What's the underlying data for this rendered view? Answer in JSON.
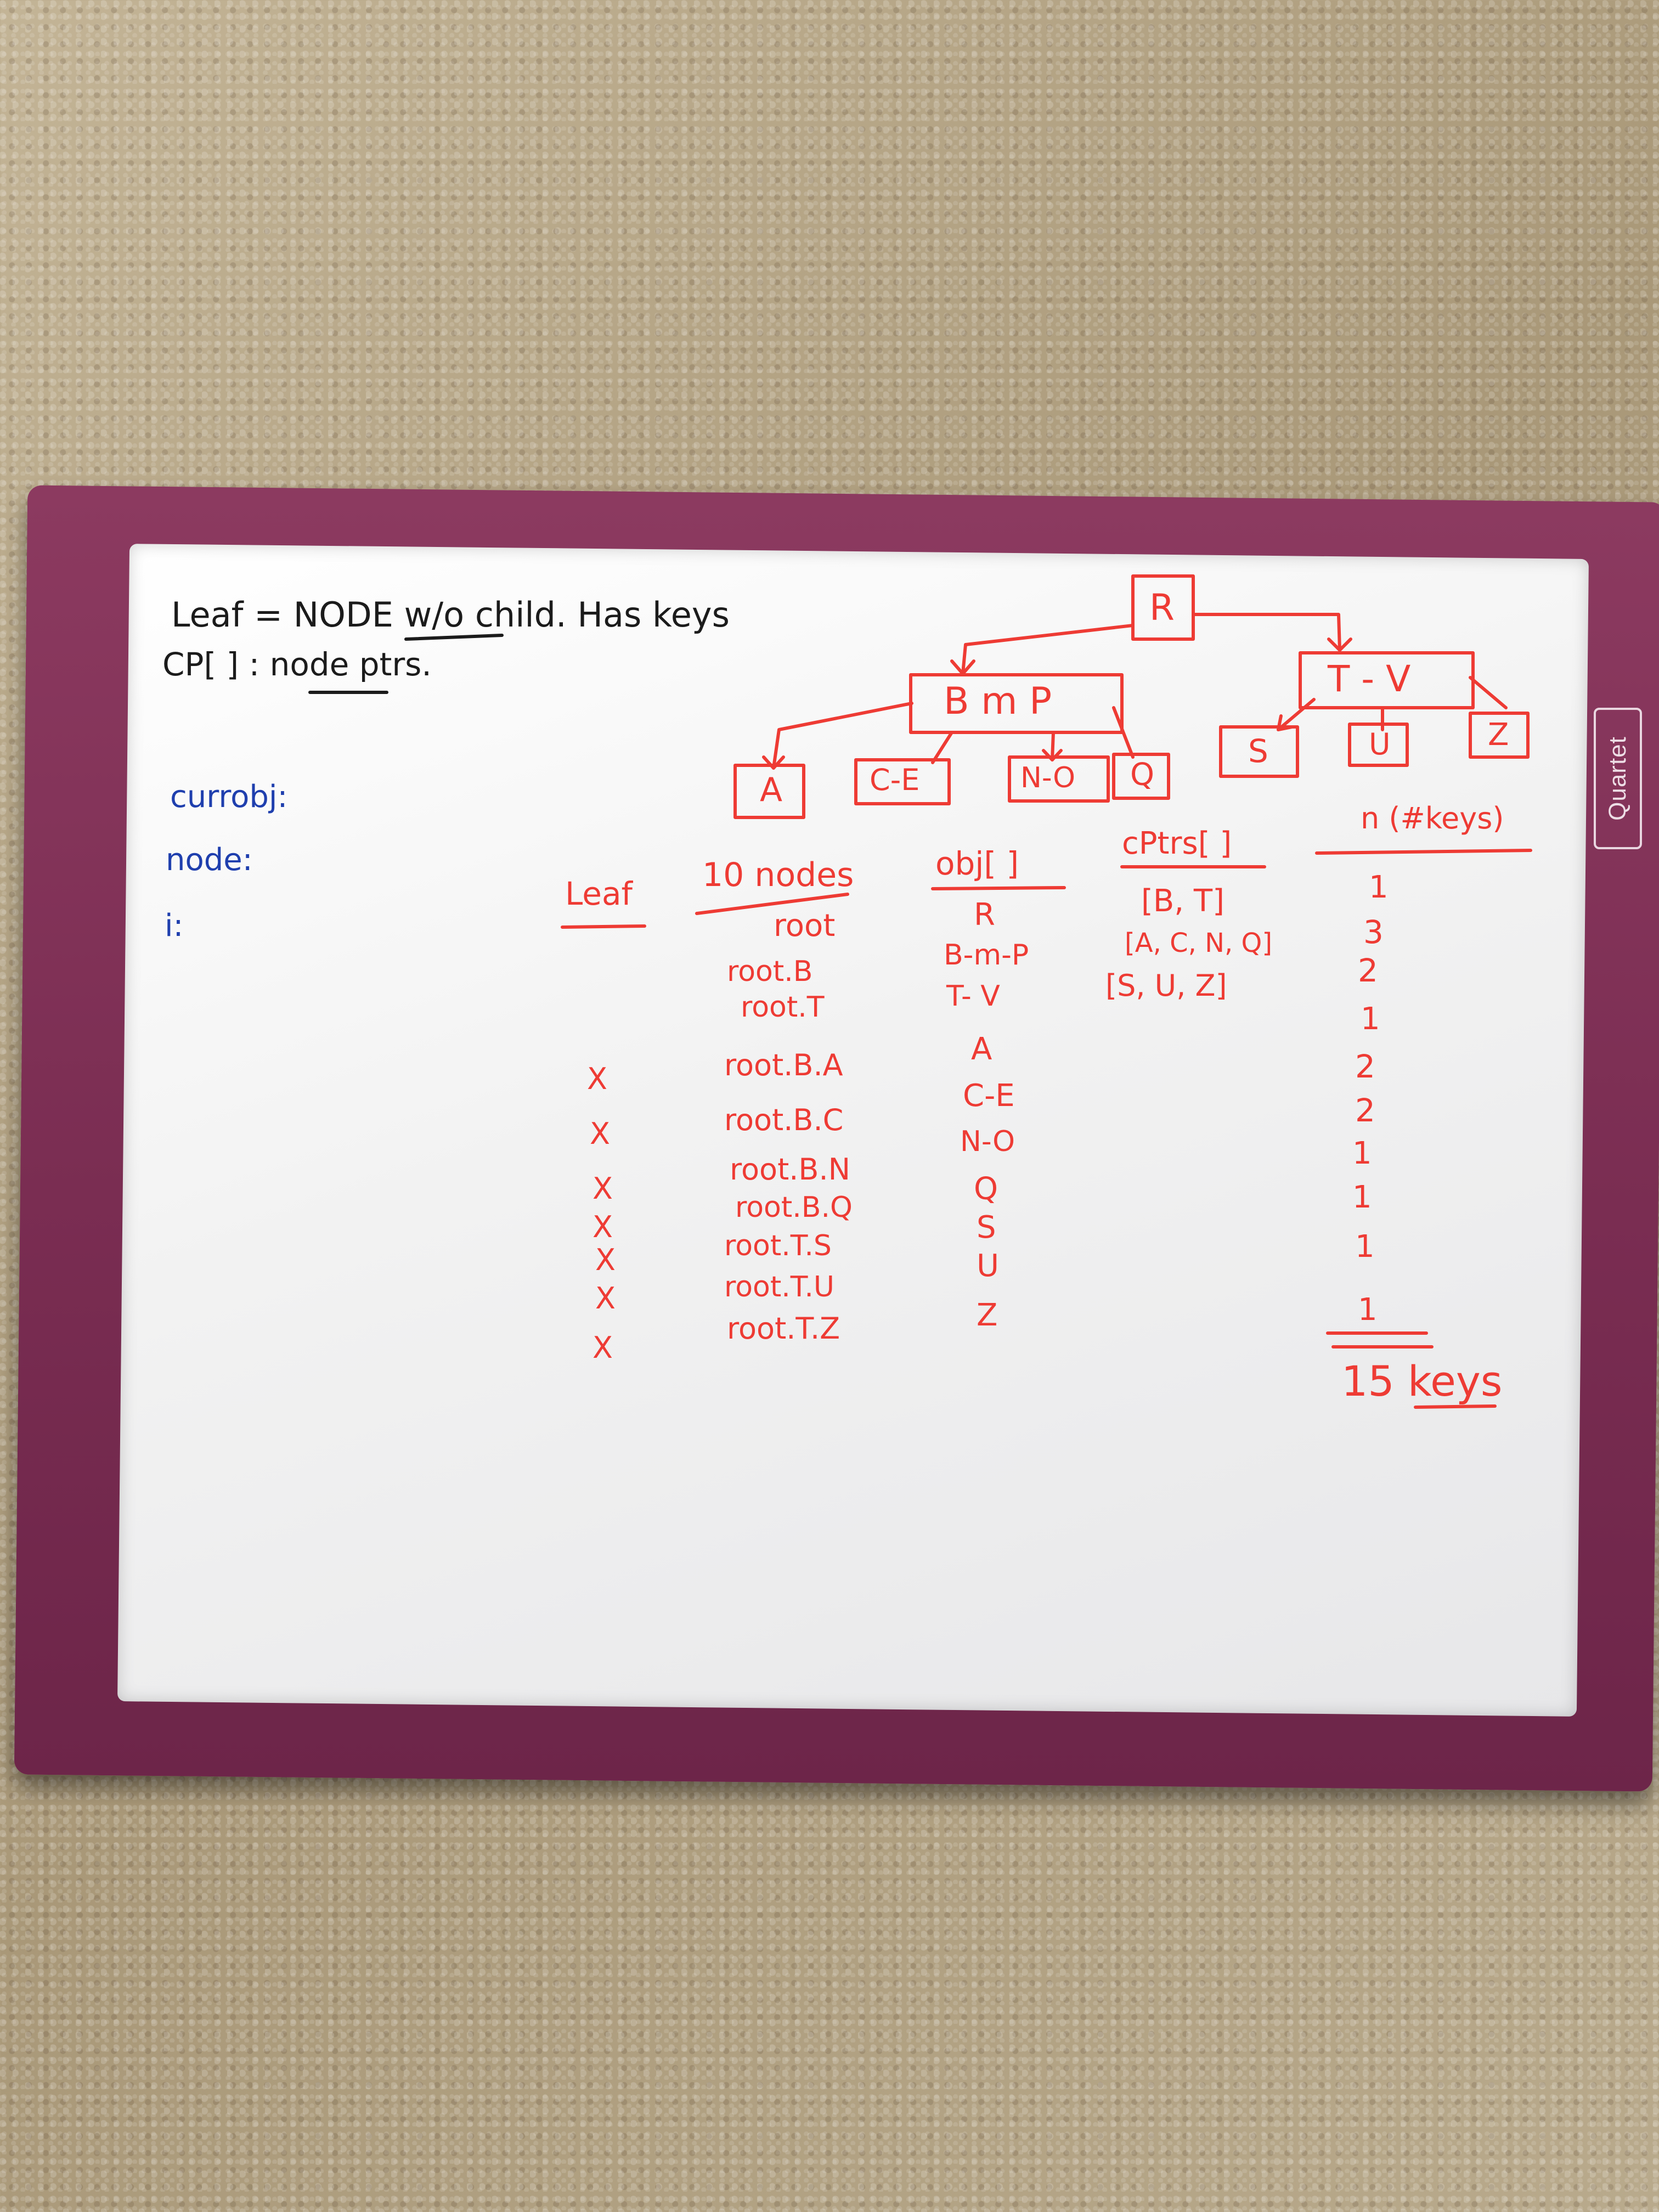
{
  "brand": "Quartet",
  "notes": {
    "line1": "Leaf = NODE w/o child. Has keys",
    "line2": "CP[ ] : node ptrs.",
    "currobj": "currobj:",
    "node": "node:",
    "i": "i:"
  },
  "tree": {
    "root": "R",
    "level1": [
      "B  m  P",
      "T - V"
    ],
    "leaves": [
      "A",
      "C-E",
      "N-O",
      "Q",
      "S",
      "U",
      "Z"
    ]
  },
  "table": {
    "headers": [
      "Leaf",
      "10 nodes",
      "obj[ ]",
      "cPtrs[ ]",
      "n (#keys)"
    ],
    "rows": [
      {
        "leaf": "",
        "node": "root",
        "obj": "R",
        "cptrs": "[B, T]",
        "n": "1"
      },
      {
        "leaf": "",
        "node": "root.B",
        "obj": "B-m-P",
        "cptrs": "[A, C, N, Q]",
        "n": "3"
      },
      {
        "leaf": "",
        "node": "root.T",
        "obj": "T- V",
        "cptrs": "[S, U, Z]",
        "n": "2"
      },
      {
        "leaf": "X",
        "node": "root.B.A",
        "obj": "A",
        "cptrs": "",
        "n": "1"
      },
      {
        "leaf": "X",
        "node": "root.B.C",
        "obj": "C-E",
        "cptrs": "",
        "n": "2"
      },
      {
        "leaf": "X",
        "node": "root.B.N",
        "obj": "N-O",
        "cptrs": "",
        "n": "2"
      },
      {
        "leaf": "X",
        "node": "root.B.Q",
        "obj": "Q",
        "cptrs": "",
        "n": "1"
      },
      {
        "leaf": "X",
        "node": "root.T.S",
        "obj": "S",
        "cptrs": "",
        "n": "1"
      },
      {
        "leaf": "X",
        "node": "root.T.U",
        "obj": "U",
        "cptrs": "",
        "n": "1"
      },
      {
        "leaf": "X",
        "node": "root.T.Z",
        "obj": "Z",
        "cptrs": "",
        "n": "1"
      }
    ],
    "total": "15 keys"
  },
  "colors": {
    "frame": "#7a2d52",
    "board": "#f4f4f4",
    "black_marker": "#1b1b1b",
    "blue_marker": "#1f3fae",
    "red_marker": "#ee3b34"
  }
}
